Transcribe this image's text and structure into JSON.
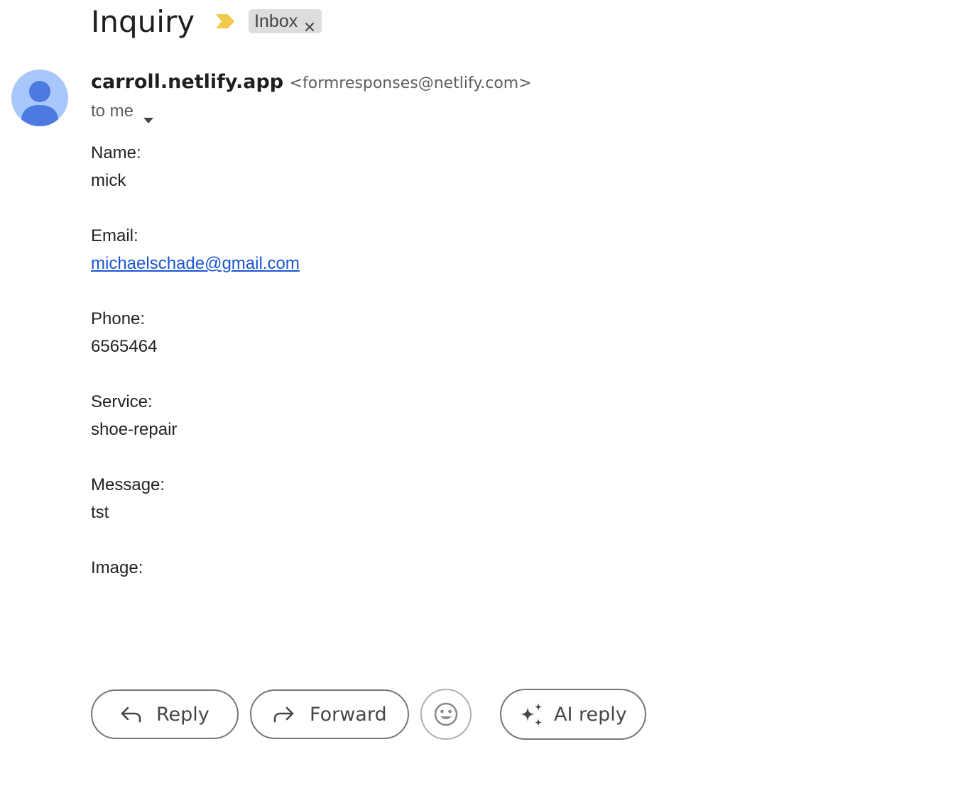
{
  "header": {
    "subject": "Inquiry",
    "importance_icon": "importance-marker-icon",
    "label_chip": "Inbox",
    "colors": {
      "importance": "#f2c94c",
      "chip_bg": "#dddddd"
    }
  },
  "sender": {
    "avatar_icon": "person-icon",
    "name": "carroll.netlify.app",
    "email": "<formresponses@netlify.com>",
    "recipient": "to me"
  },
  "body": {
    "fields": [
      {
        "label": "Name:",
        "value": "mick"
      },
      {
        "label": "Email:",
        "value": "michaelschade@gmail.com"
      },
      {
        "label": "Phone:",
        "value": "6565464"
      },
      {
        "label": "Service:",
        "value": "shoe-repair"
      },
      {
        "label": "Message:",
        "value": "tst"
      },
      {
        "label": "Image:",
        "value": ""
      }
    ]
  },
  "actions": {
    "reply_label": "Reply",
    "forward_label": "Forward",
    "emoji_icon": "emoji-smile-icon",
    "ai_reply_label": "AI reply"
  }
}
